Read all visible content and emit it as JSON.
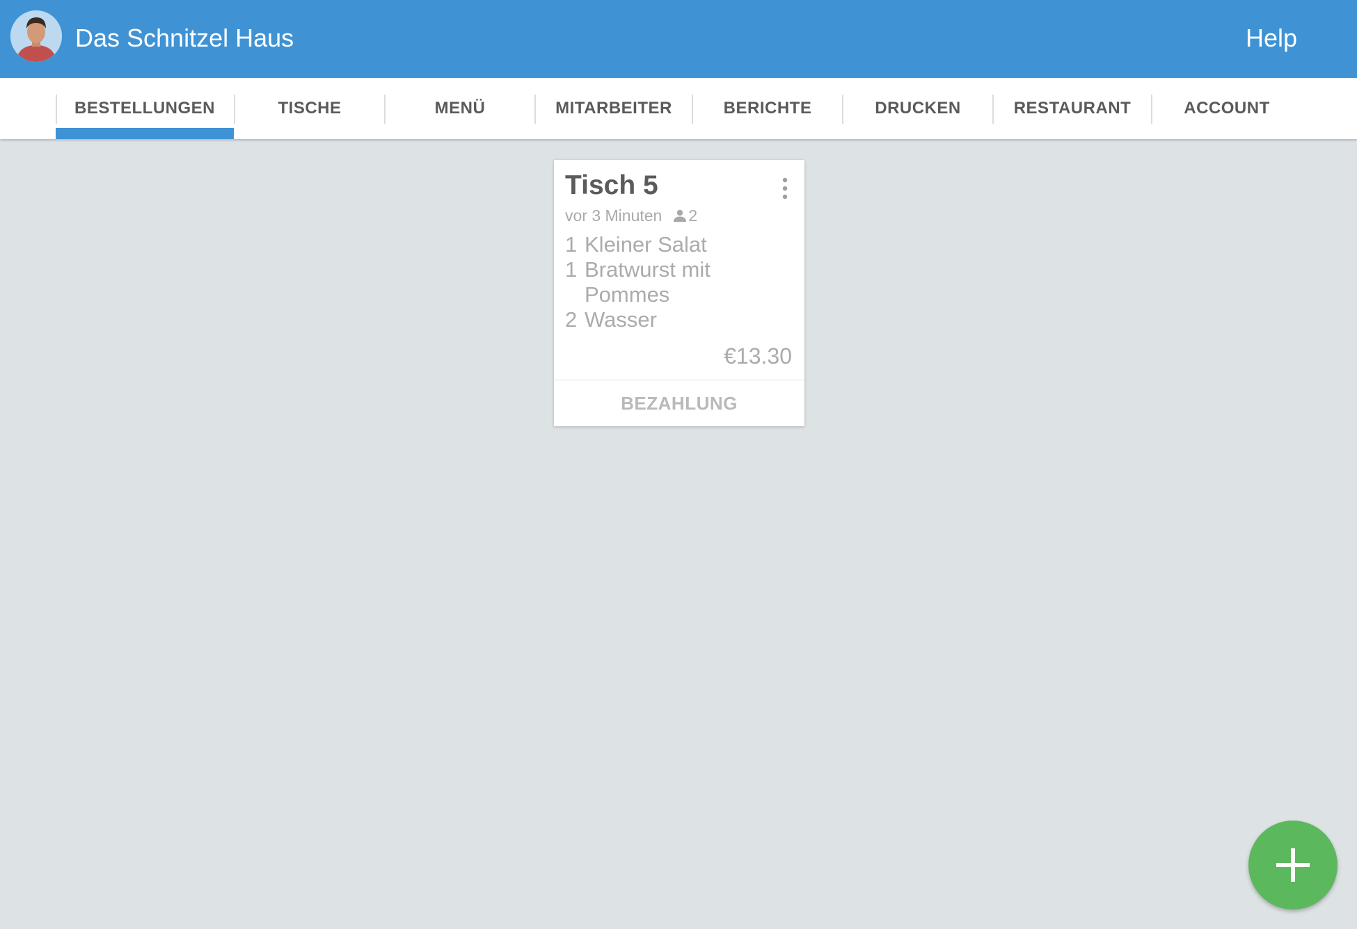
{
  "app": {
    "title": "Das Schnitzel Haus",
    "help_label": "Help",
    "avatar_icon": "user-avatar",
    "accent_color": "#3f93d4"
  },
  "tabs": [
    {
      "label": "BESTELLUNGEN",
      "active": true
    },
    {
      "label": "TISCHE",
      "active": false
    },
    {
      "label": "MENÜ",
      "active": false
    },
    {
      "label": "MITARBEITER",
      "active": false
    },
    {
      "label": "BERICHTE",
      "active": false
    },
    {
      "label": "DRUCKEN",
      "active": false
    },
    {
      "label": "RESTAURANT",
      "active": false
    },
    {
      "label": "ACCOUNT",
      "active": false
    }
  ],
  "order": {
    "table": "Tisch 5",
    "time_ago": "vor 3 Minuten",
    "guests": "2",
    "items": [
      {
        "qty": "1",
        "name": "Kleiner Salat"
      },
      {
        "qty": "1",
        "name": "Bratwurst mit Pommes"
      },
      {
        "qty": "2",
        "name": "Wasser"
      }
    ],
    "total": "€13.30",
    "pay_label": "BEZAHLUNG",
    "menu_icon": "more-vert-icon",
    "guest_icon": "person-icon"
  },
  "fab": {
    "icon": "plus-icon",
    "color": "#5cb85c"
  }
}
